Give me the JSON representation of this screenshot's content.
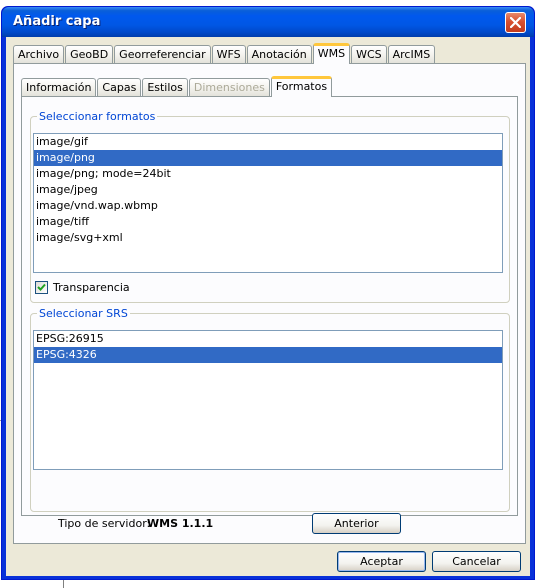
{
  "window": {
    "title": "Añadir capa"
  },
  "outer_tabs": [
    {
      "label": "Archivo",
      "active": false
    },
    {
      "label": "GeoBD",
      "active": false
    },
    {
      "label": "Georreferenciar",
      "active": false
    },
    {
      "label": "WFS",
      "active": false
    },
    {
      "label": "Anotación",
      "active": false
    },
    {
      "label": "WMS",
      "active": true
    },
    {
      "label": "WCS",
      "active": false
    },
    {
      "label": "ArcIMS",
      "active": false
    }
  ],
  "inner_tabs": [
    {
      "label": "Información",
      "active": false,
      "disabled": false
    },
    {
      "label": "Capas",
      "active": false,
      "disabled": false
    },
    {
      "label": "Estilos",
      "active": false,
      "disabled": false
    },
    {
      "label": "Dimensiones",
      "active": false,
      "disabled": true
    },
    {
      "label": "Formatos",
      "active": true,
      "disabled": false
    }
  ],
  "formats": {
    "legend": "Seleccionar formatos",
    "items": [
      "image/gif",
      "image/png",
      "image/png; mode=24bit",
      "image/jpeg",
      "image/vnd.wap.wbmp",
      "image/tiff",
      "image/svg+xml"
    ],
    "selected": "image/png"
  },
  "transparency": {
    "label": "Transparencia",
    "checked": true
  },
  "srs": {
    "legend": "Seleccionar SRS",
    "items": [
      "EPSG:26915",
      "EPSG:4326"
    ],
    "selected": "EPSG:4326"
  },
  "footer": {
    "server_type_label": "Tipo de servidor:",
    "server_type_value": "WMS 1.1.1",
    "back_button": "Anterior"
  },
  "buttons": {
    "accept": "Aceptar",
    "cancel": "Cancelar"
  },
  "colors": {
    "title_bar": "#0058ee",
    "selection": "#316ac5",
    "active_tab_accent": "#ffc73c",
    "legend_text": "#0046d5"
  },
  "icons": {
    "close": "close-icon",
    "check": "checkmark-icon"
  }
}
